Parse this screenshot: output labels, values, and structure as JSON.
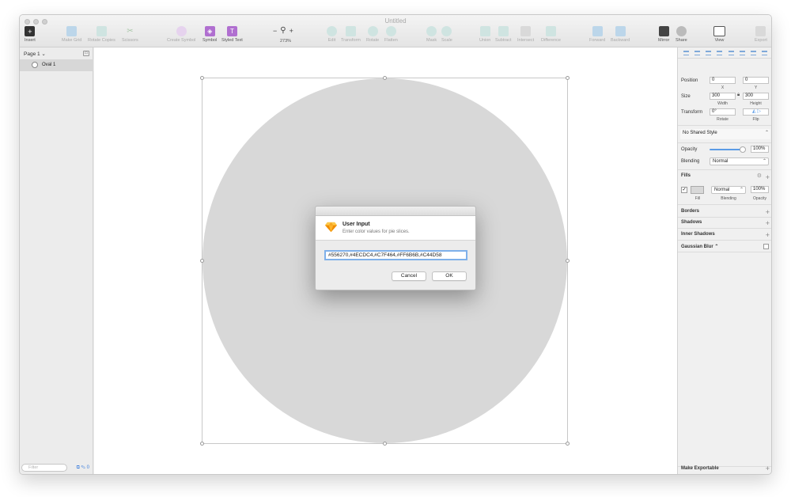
{
  "window": {
    "title": "Untitled"
  },
  "toolbar": {
    "insert": "Insert",
    "make_grid": "Make Grid",
    "rotate_copies": "Rotate Copies",
    "scissors": "Scissors",
    "create_symbol": "Create Symbol",
    "symbol": "Symbol",
    "styled_text": "Styled Text",
    "zoom_out": "−",
    "zoom_in": "+",
    "zoom_level": "273%",
    "edit": "Edit",
    "transform": "Transform",
    "rotate": "Rotate",
    "flatten": "Flatten",
    "mask": "Mask",
    "scale": "Scale",
    "union": "Union",
    "subtract": "Subtract",
    "intersect": "Intersect",
    "difference": "Difference",
    "forward": "Forward",
    "backward": "Backward",
    "mirror": "Mirror",
    "share": "Share",
    "view": "View",
    "export": "Export"
  },
  "layers": {
    "page_selector": "Page 1 ⌄",
    "items": [
      {
        "name": "Oval 1"
      }
    ],
    "filter_placeholder": "Filter",
    "layer_count": "0"
  },
  "inspector": {
    "position_label": "Position",
    "position_x": "0",
    "position_y": "0",
    "x_label": "X",
    "y_label": "Y",
    "size_label": "Size",
    "width": "300",
    "height": "300",
    "width_label": "Width",
    "height_label": "Height",
    "transform_label": "Transform",
    "rotate_value": "0°",
    "rotate_label": "Rotate",
    "flip_label": "Flip",
    "shared_style": "No Shared Style",
    "opacity_label": "Opacity",
    "opacity_value": "100%",
    "blending_label": "Blending",
    "blending_value": "Normal",
    "fills_label": "Fills",
    "fill_blending": "Normal",
    "fill_opacity": "100%",
    "fill_sub": "Fill",
    "blending_sub": "Blending",
    "opacity_sub": "Opacity",
    "borders_label": "Borders",
    "shadows_label": "Shadows",
    "inner_shadows_label": "Inner Shadows",
    "gaussian_blur_label": "Gaussian Blur ⌃",
    "make_exportable": "Make Exportable"
  },
  "dialog": {
    "title": "User Input",
    "subtitle": "Enter color values for pie slices.",
    "input_value": "#556270,#4ECDC4,#C7F464,#FF6B6B,#C44D58",
    "cancel_label": "Cancel",
    "ok_label": "OK"
  },
  "colors": {
    "oval_fill": "#d8d8d8",
    "accent": "#5a9be6",
    "symbol_purple": "#b06fd0"
  }
}
